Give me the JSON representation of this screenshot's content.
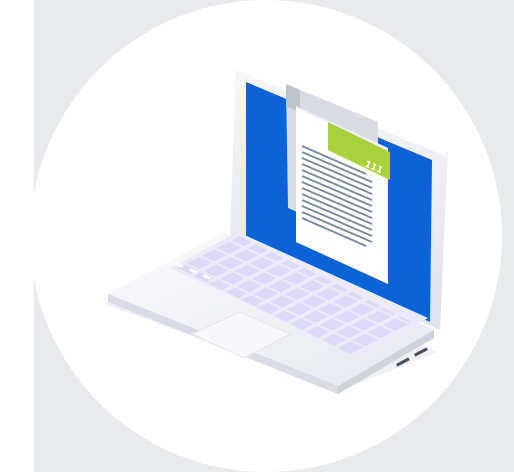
{
  "illustration": {
    "icon": "laptop-document-icon",
    "badge_label": "111",
    "colors": {
      "panel_background": "#e9eaee",
      "circle_background": "#ffffff",
      "screen_blue": "#0b63d6",
      "badge_green": "#a9d13b",
      "keyboard_lilac": "#e7e6fb",
      "laptop_body": "#f4f5f8"
    }
  }
}
